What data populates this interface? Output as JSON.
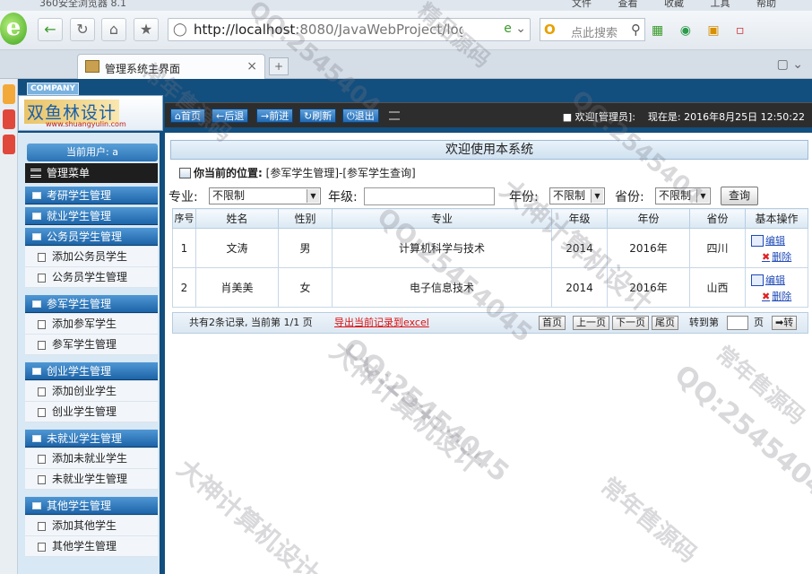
{
  "browser": {
    "title_partial": "360安全浏览器 8.1",
    "menus": [
      "文件",
      "查看",
      "收藏",
      "工具",
      "帮助"
    ],
    "url_host": "http://localhost",
    "url_rest": ":8080/JavaWebProject/logi",
    "search_placeholder": "点此搜索",
    "tab_title": "管理系统主界面",
    "new_tab": "+"
  },
  "app": {
    "company_label": "COMPANY",
    "brand_title": "双鱼林设计",
    "brand_url": "www.shuangyulin.com",
    "toolbar": {
      "home": "首页",
      "back": "后退",
      "forward": "前进",
      "refresh": "刷新",
      "logout": "退出"
    },
    "welcome_user": "■ 欢迎[管理员]:",
    "now_label": "现在是: 2016年8月25日 12:50:22"
  },
  "sidebar": {
    "current_user": "当前用户: a",
    "menu_title": "管理菜单",
    "sections": [
      {
        "label": "考研学生管理",
        "items": []
      },
      {
        "label": "就业学生管理",
        "items": []
      },
      {
        "label": "公务员学生管理",
        "items": [
          "添加公务员学生",
          "公务员学生管理"
        ]
      },
      {
        "label": "参军学生管理",
        "items": [
          "添加参军学生",
          "参军学生管理"
        ]
      },
      {
        "label": "创业学生管理",
        "items": [
          "添加创业学生",
          "创业学生管理"
        ]
      },
      {
        "label": "未就业学生管理",
        "items": [
          "添加未就业学生",
          "未就业学生管理"
        ]
      },
      {
        "label": "其他学生管理",
        "items": [
          "添加其他学生",
          "其他学生管理"
        ]
      }
    ]
  },
  "main": {
    "welcome": "欢迎使用本系统",
    "location_label": "你当前的位置:",
    "location_path": "[参军学生管理]-[参军学生查询]",
    "filters": {
      "major_label": "专业:",
      "major_value": "不限制",
      "grade_label": "年级:",
      "grade_value": "",
      "year_label": "年份:",
      "year_value": "不限制",
      "province_label": "省份:",
      "province_value": "不限制",
      "query_button": "查询"
    },
    "table": {
      "headers": [
        "序号",
        "姓名",
        "性别",
        "专业",
        "年级",
        "年份",
        "省份",
        "基本操作"
      ],
      "rows": [
        [
          "1",
          "文涛",
          "男",
          "计算机科学与技术",
          "2014",
          "2016年",
          "四川"
        ],
        [
          "2",
          "肖美美",
          "女",
          "电子信息技术",
          "2014",
          "2016年",
          "山西"
        ]
      ],
      "edit_label": "编辑",
      "delete_label": "删除"
    },
    "pager": {
      "summary": "共有2条记录, 当前第 1/1 页",
      "export": "导出当前记录到excel",
      "first": "首页",
      "prev": "上一页",
      "next": "下一页",
      "last": "尾页",
      "jump_label": "转到第",
      "page_unit": "页",
      "go": "➡转"
    }
  },
  "watermarks": [
    "QQ:2545404",
    "大神计算机设计",
    "常年售源码",
    "QQ:25454045",
    "大神计算机设计",
    "QQ:25454045",
    "常年售源码",
    "大神计算机设计",
    "QQ:2545404",
    "QQ:25454045",
    "常年售源码",
    "精品源码"
  ]
}
